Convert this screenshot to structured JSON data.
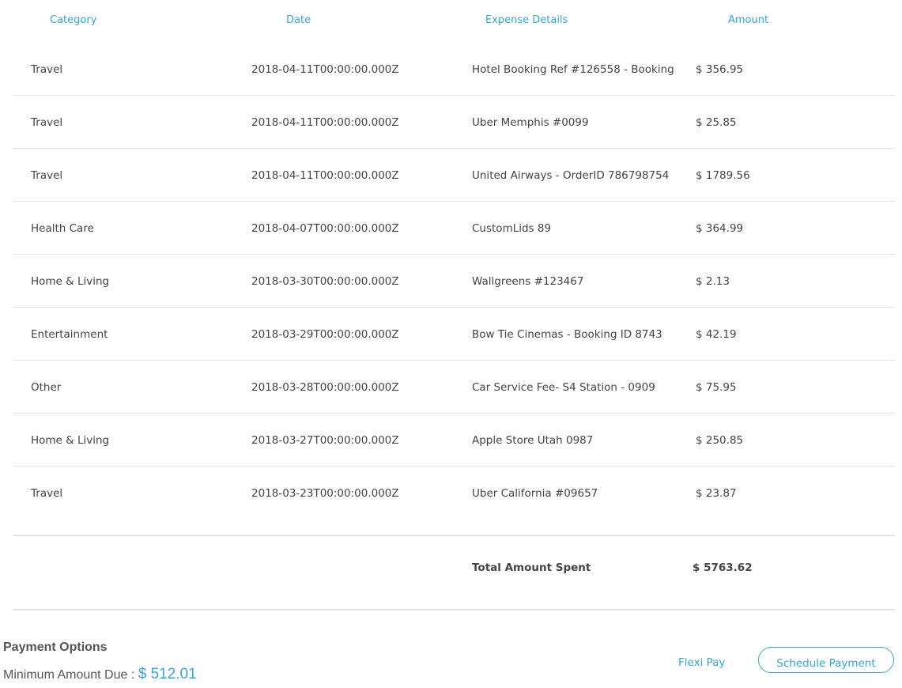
{
  "columns": {
    "category": "Category",
    "date": "Date",
    "details": "Expense Details",
    "amount": "Amount"
  },
  "rows": [
    {
      "category": "Travel",
      "date": "2018-04-11T00:00:00.000Z",
      "details": "Hotel Booking Ref #126558 - Booking",
      "amount": "$ 356.95"
    },
    {
      "category": "Travel",
      "date": "2018-04-11T00:00:00.000Z",
      "details": "Uber Memphis #0099",
      "amount": "$ 25.85"
    },
    {
      "category": "Travel",
      "date": "2018-04-11T00:00:00.000Z",
      "details": "United Airways - OrderID 786798754",
      "amount": "$ 1789.56"
    },
    {
      "category": "Health Care",
      "date": "2018-04-07T00:00:00.000Z",
      "details": "CustomLids 89",
      "amount": "$ 364.99"
    },
    {
      "category": "Home & Living",
      "date": "2018-03-30T00:00:00.000Z",
      "details": "Wallgreens #123467",
      "amount": "$ 2.13"
    },
    {
      "category": "Entertainment",
      "date": "2018-03-29T00:00:00.000Z",
      "details": "Bow Tie Cinemas - Booking ID 8743",
      "amount": "$ 42.19"
    },
    {
      "category": "Other",
      "date": "2018-03-28T00:00:00.000Z",
      "details": "Car Service Fee- S4 Station - 0909",
      "amount": "$ 75.95"
    },
    {
      "category": "Home & Living",
      "date": "2018-03-27T00:00:00.000Z",
      "details": "Apple Store Utah 0987",
      "amount": "$ 250.85"
    },
    {
      "category": "Travel",
      "date": "2018-03-23T00:00:00.000Z",
      "details": "Uber California #09657",
      "amount": "$ 23.87"
    }
  ],
  "total": {
    "label": "Total Amount Spent",
    "value": "$ 5763.62"
  },
  "payment": {
    "title": "Payment Options",
    "min_due_label": "Minimum Amount Due : ",
    "min_due_value": "$ 512.01",
    "flexi_pay": "Flexi Pay",
    "schedule_payment": "Schedule Payment"
  },
  "colors": {
    "accent": "#2fa8dc",
    "text": "#444444",
    "divider": "#e3e3e3"
  }
}
